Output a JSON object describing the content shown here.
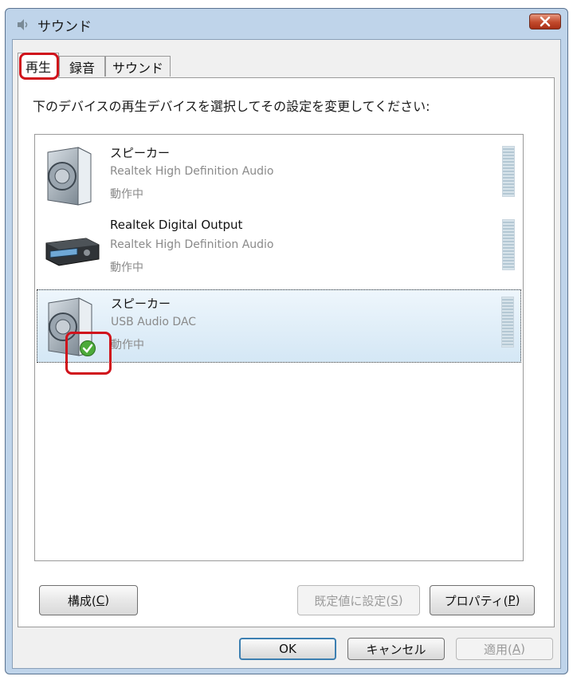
{
  "window": {
    "title": "サウンド"
  },
  "tabs": [
    {
      "label": "再生"
    },
    {
      "label": "録音"
    },
    {
      "label": "サウンド"
    }
  ],
  "instruction": "下のデバイスの再生デバイスを選択してその設定を変更してください:",
  "devices": [
    {
      "name": "スピーカー",
      "driver": "Realtek High Definition Audio",
      "status": "動作中",
      "icon": "speaker-icon"
    },
    {
      "name": "Realtek Digital Output",
      "driver": "Realtek High Definition Audio",
      "status": "動作中",
      "icon": "digital-output-device-icon"
    },
    {
      "name": "スピーカー",
      "driver": "USB Audio DAC",
      "status": "動作中",
      "icon": "speaker-icon",
      "default_badge_icon": "checkmark-icon"
    }
  ],
  "buttons": {
    "configure": {
      "text": "構成(",
      "key": "C",
      "end": ")"
    },
    "set_default": {
      "text": "既定値に設定(",
      "key": "S",
      "end": ")"
    },
    "properties": {
      "text": "プロパティ(",
      "key": "P",
      "end": ")"
    },
    "ok": "OK",
    "cancel": "キャンセル",
    "apply": {
      "text": "適用(",
      "key": "A",
      "end": ")"
    }
  },
  "colors": {
    "highlight": "#d0121b",
    "selection": "#d4e7f5",
    "titlebar": "#bfd4ea"
  }
}
